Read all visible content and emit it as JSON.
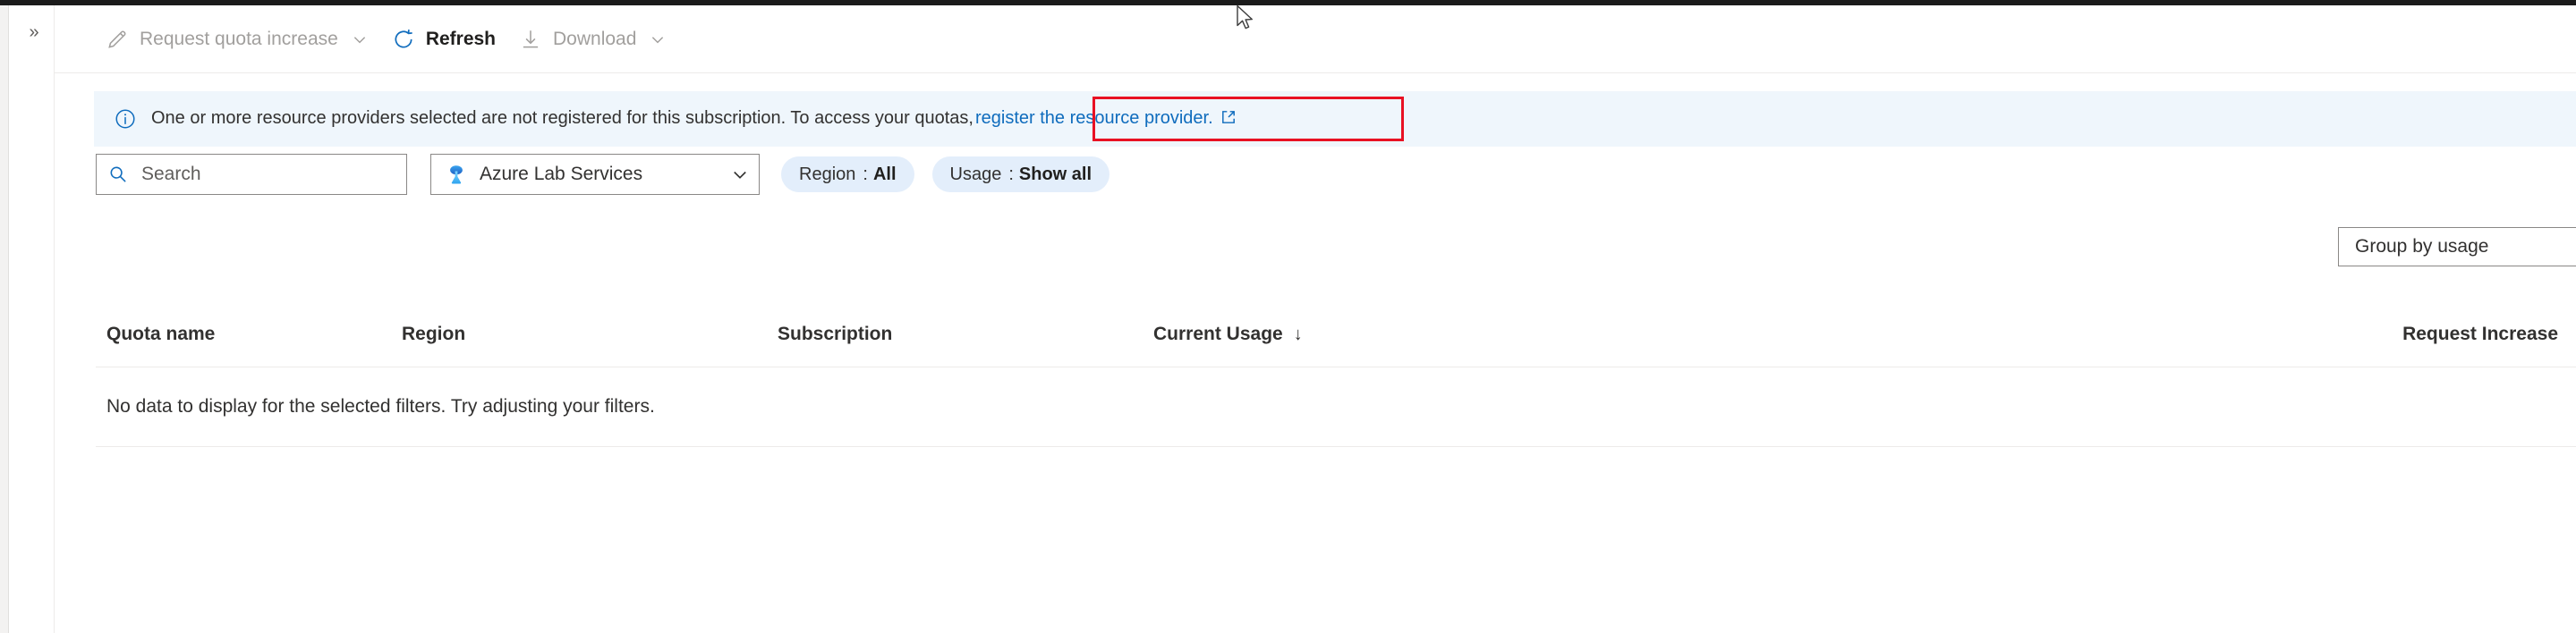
{
  "window": {
    "expand_chevron": "»"
  },
  "toolbar": {
    "items": [
      {
        "label": "Request quota increase",
        "icon": "pencil-icon",
        "caret": true,
        "disabled": true
      },
      {
        "label": "Refresh",
        "icon": "refresh-icon",
        "caret": false,
        "disabled": false
      },
      {
        "label": "Download",
        "icon": "download-icon",
        "caret": true,
        "disabled": true
      }
    ]
  },
  "notification": {
    "icon": "info-circle-icon",
    "message": "One or more resource providers selected are not registered for this subscription. To access your quotas,",
    "link_text": "register the resource provider.",
    "link_icon": "external-link-icon",
    "highlight_color": "#e81123"
  },
  "filters": {
    "search": {
      "placeholder": "Search",
      "value": "",
      "icon": "search-icon"
    },
    "provider": {
      "label": "Azure Lab Services",
      "icon": "azure-lab-services-icon",
      "caret": "chevron-down-icon"
    },
    "pills": [
      {
        "name": "Region",
        "separator": ":",
        "value": "All"
      },
      {
        "name": "Usage",
        "separator": ":",
        "value": "Show all"
      }
    ]
  },
  "group_by": {
    "label": "Group by usage"
  },
  "table": {
    "columns": [
      {
        "label": "Quota name",
        "sort": ""
      },
      {
        "label": "Region",
        "sort": ""
      },
      {
        "label": "Subscription",
        "sort": ""
      },
      {
        "label": "Current Usage",
        "sort": "↓"
      },
      {
        "label": "Request Increase",
        "sort": ""
      }
    ],
    "empty_message": "No data to display for the selected filters. Try adjusting your filters.",
    "rows": []
  },
  "colors": {
    "accent": "#0f6cbd",
    "banner_bg": "#eff6fc",
    "pill_bg": "#e3eefb",
    "annotation": "#e81123"
  }
}
